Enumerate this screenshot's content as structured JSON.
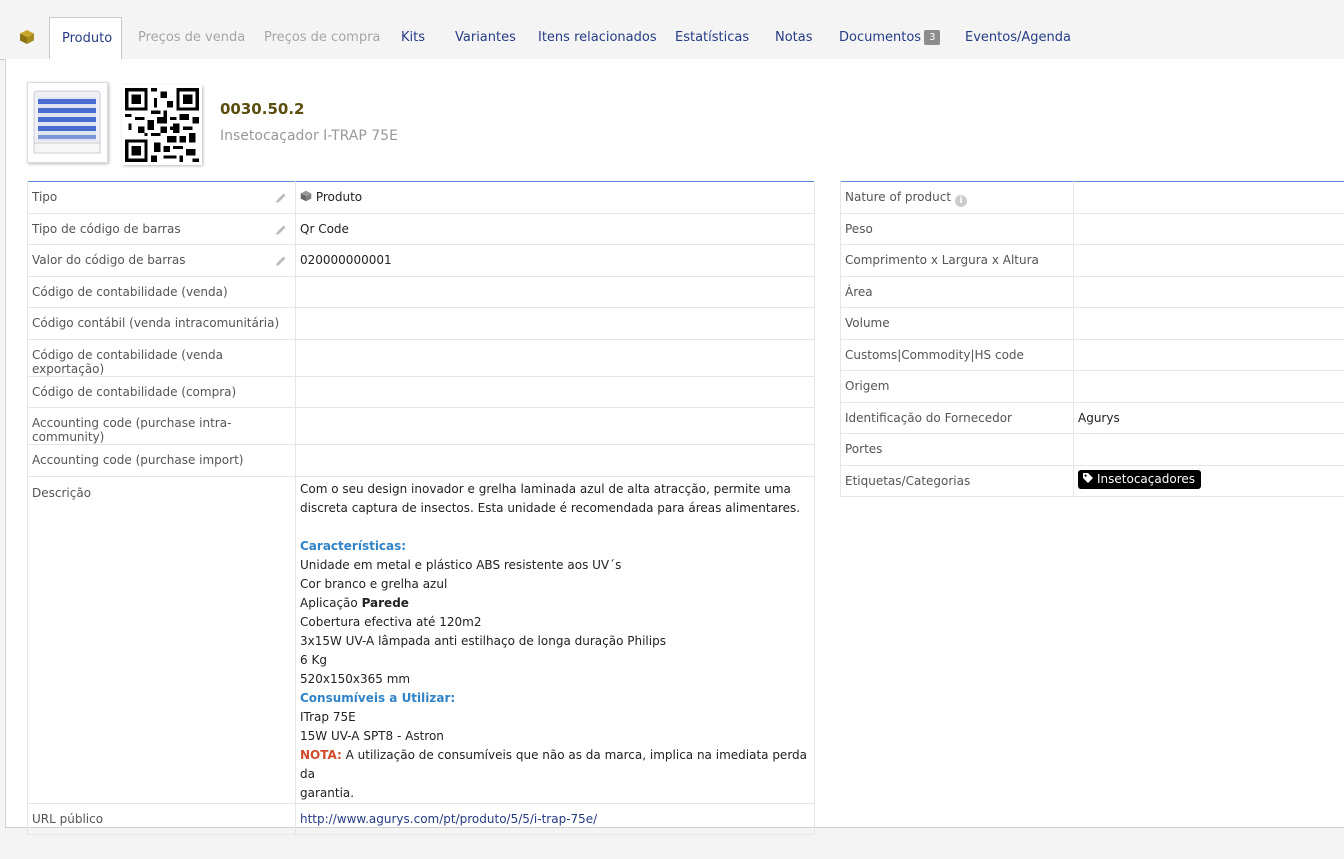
{
  "tabs": [
    {
      "label": "Produto",
      "state": "active"
    },
    {
      "label": "Preços de venda",
      "state": "disabled"
    },
    {
      "label": "Preços de compra",
      "state": "disabled"
    },
    {
      "label": "Kits",
      "state": "normal"
    },
    {
      "label": "Variantes",
      "state": "normal"
    },
    {
      "label": "Itens relacionados",
      "state": "normal"
    },
    {
      "label": "Estatísticas",
      "state": "normal"
    },
    {
      "label": "Notas",
      "state": "normal"
    },
    {
      "label": "Documentos",
      "state": "normal",
      "badge": "3"
    },
    {
      "label": "Eventos/Agenda",
      "state": "normal"
    }
  ],
  "header": {
    "ref": "0030.50.2",
    "label": "Insetocaçador I-TRAP 75E"
  },
  "left": {
    "tipo_label": "Tipo",
    "tipo_value": "Produto",
    "barcode_type_label": "Tipo de código de barras",
    "barcode_type_value": "Qr Code",
    "barcode_value_label": "Valor do código de barras",
    "barcode_value": "020000000001",
    "acc_sale_label": "Código de contabilidade (venda)",
    "acc_sale_intra_label": "Código contábil (venda intracomunitária)",
    "acc_sale_export_label": "Código de contabilidade (venda exportação)",
    "acc_buy_label": "Código de contabilidade (compra)",
    "acc_buy_intra_label": "Accounting code (purchase intra-community)",
    "acc_buy_import_label": "Accounting code (purchase import)",
    "desc_label": "Descrição",
    "desc": {
      "intro1": "Com o seu design inovador e grelha laminada azul de alta atracção, permite uma",
      "intro2": "discreta captura de insectos. Esta unidade é recomendada para áreas alimentares.",
      "features_title": "Características:",
      "f1": "Unidade em metal e plástico ABS resistente aos UV´s",
      "f2": "Cor branco e grelha azul",
      "f3_prefix": "Aplicação ",
      "f3_bold": "Parede",
      "f4": "Cobertura efectiva até 120m2",
      "f5": "3x15W UV-A lâmpada anti estilhaço de longa duração Philips",
      "f6": "6 Kg",
      "f7": "520x150x365 mm",
      "consumables_title": "Consumíveis a Utilizar:",
      "c1": "ITrap 75E",
      "c2": "15W UV-A SPT8 - Astron",
      "note_label": "NOTA:",
      "note_text1": " A utilização de consumíveis que não as da marca, implica na imediata perda da",
      "note_text2": "garantia."
    },
    "url_label": "URL público",
    "url_value": "http://www.agurys.com/pt/produto/5/5/i-trap-75e/"
  },
  "right": {
    "nature_label": "Nature of product",
    "weight_label": "Peso",
    "dims_label": "Comprimento x Largura x Altura",
    "area_label": "Área",
    "volume_label": "Volume",
    "customs_label": "Customs|Commodity|HS code",
    "origin_label": "Origem",
    "supplier_label": "Identificação do Fornecedor",
    "supplier_value": "Agurys",
    "ports_label": "Portes",
    "tags_label": "Etiquetas/Categorias",
    "tag_value": "Insetocaçadores"
  },
  "icons": {
    "tab": "cube-icon",
    "edit": "pencil-icon",
    "info": "info-icon",
    "tag": "tag-icon"
  }
}
